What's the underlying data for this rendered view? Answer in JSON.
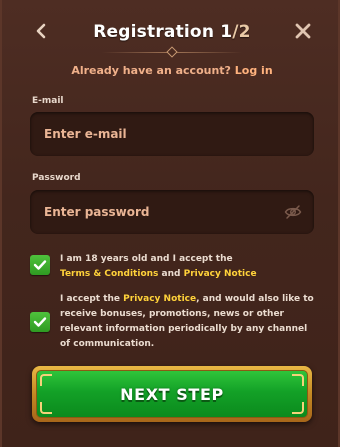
{
  "header": {
    "title_step": "Registration 1",
    "title_total": "/2",
    "back_icon": "chevron-left-icon",
    "close_icon": "close-icon"
  },
  "login_prompt": {
    "text": "Already have an account?",
    "link": "Log in"
  },
  "email": {
    "label": "E-mail",
    "placeholder": "Enter e-mail"
  },
  "password": {
    "label": "Password",
    "placeholder": "Enter password",
    "toggle_icon": "eye-off-icon"
  },
  "consents": [
    {
      "checked": true,
      "text_before": "I am 18 years old and I accept the",
      "link1": "Terms & Conditions",
      "mid": " and ",
      "link2": "Privacy Notice"
    },
    {
      "checked": true,
      "text_before": "I accept the ",
      "link1": "Privacy Notice",
      "text_after": ", and would also like to receive bonuses, promotions, news or other relevant information periodically by any channel of communication."
    }
  ],
  "next_button": {
    "label": "NEXT STEP"
  },
  "colors": {
    "panel_bg": "#4e2d23",
    "accent_green": "#13a127",
    "highlight": "#ffd23a",
    "link_orange": "#ffb27e",
    "gold_border": "#e9b845"
  }
}
